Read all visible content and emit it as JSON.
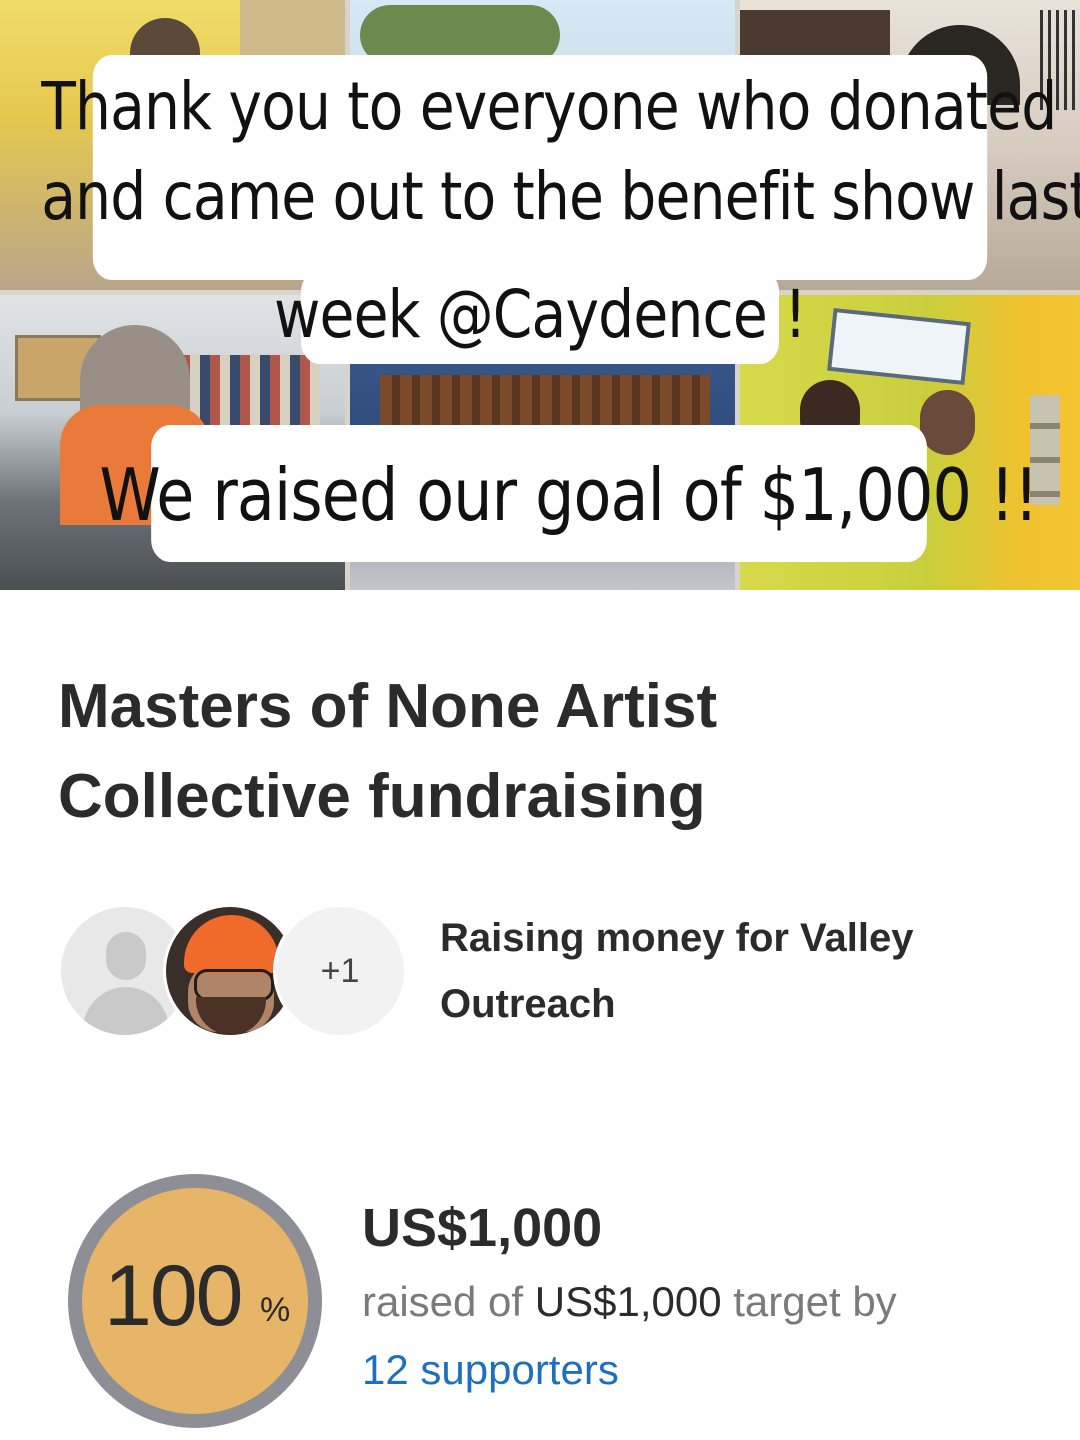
{
  "hero": {
    "caption_line_1": "Thank you to everyone who donated",
    "caption_line_2": "and came out to the benefit show last",
    "caption_line_3": "week @Caydence !",
    "caption_goal": "We raised our goal of $1,000 !!"
  },
  "page_title": "Masters of None Artist Collective fundraising",
  "team": {
    "extra_count_label": "+1",
    "raising_for_text": "Raising money for Valley Outreach"
  },
  "progress": {
    "percent": 100,
    "percent_label": "100",
    "percent_sign": "%",
    "amount_raised": "US$1,000",
    "raised_of_text": "raised of ",
    "target_amount": "US$1,000",
    "target_by_text": " target by",
    "supporters_link": "12 supporters"
  },
  "colors": {
    "ring": "#8e8e96",
    "progress_fill": "#e6b567",
    "link": "#1f6fbf"
  }
}
